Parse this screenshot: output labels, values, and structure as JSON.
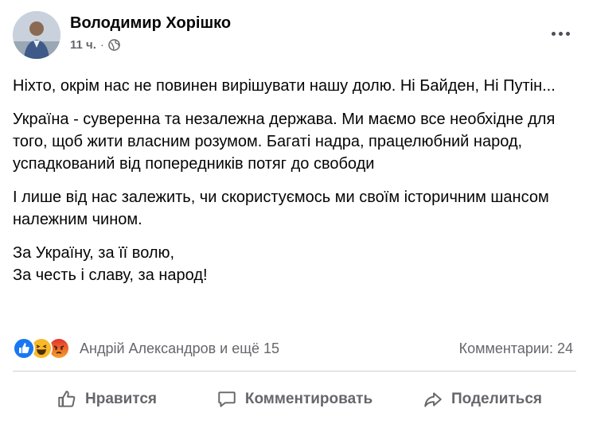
{
  "post": {
    "author": "Володимир Хорішко",
    "time": "11 ч.",
    "separator": "·",
    "paragraphs": [
      "Ніхто, окрім нас не повинен вирішувати нашу долю. Ні Байден, Ні Путін...",
      "Україна - суверенна та незалежна держава. Ми маємо все необхідне для того, щоб жити власним розумом. Багаті надра, працелюбний народ, успадкований від попередників потяг до свободи",
      "І лише від нас залежить, чи скористуємось ми своїм історичним шансом належним чином.",
      "За Україну, за її волю,\nЗа честь і славу, за народ!"
    ]
  },
  "reactions": {
    "icons": [
      "like-icon",
      "haha-icon",
      "angry-icon"
    ],
    "names": "Андрій Александров и ещё 15",
    "comments": "Комментарии: 24"
  },
  "actions": {
    "like": "Нравится",
    "comment": "Комментировать",
    "share": "Поделиться"
  },
  "colors": {
    "text": "#050505",
    "secondary": "#65676b",
    "like_blue": "#1877f2",
    "haha_yellow": "#f7b928",
    "angry_orange": "#e9710f",
    "divider": "#ced0d4"
  }
}
